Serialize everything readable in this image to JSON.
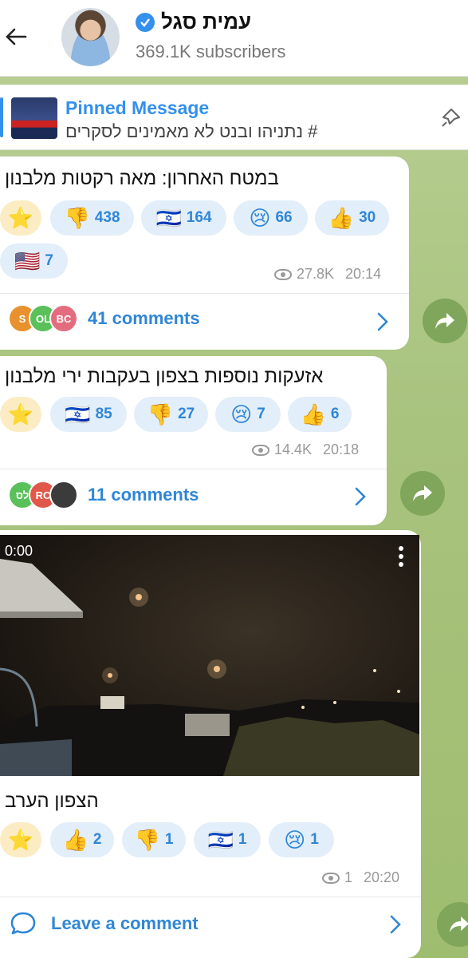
{
  "header": {
    "title": "עמית סגל",
    "subscribers": "369.1K subscribers"
  },
  "pinned": {
    "title": "Pinned Message",
    "text": "# נתניהו ובנט לא מאמינים לסקרים"
  },
  "messages": [
    {
      "text": "במטח האחרון: מאה רקטות מלבנון",
      "reactions": [
        {
          "emoji": "👎",
          "count": "438"
        },
        {
          "emoji": "🇮🇱",
          "count": "164"
        },
        {
          "emoji": "😢",
          "count": "66"
        },
        {
          "emoji": "👍",
          "count": "30"
        },
        {
          "emoji": "🇺🇸",
          "count": "7"
        }
      ],
      "views": "27.8K",
      "time": "20:14",
      "comments": "41 comments",
      "commenters": [
        "S",
        "OL",
        "BC"
      ]
    },
    {
      "text": "אזעקות נוספות בצפון בעקבות ירי מלבנון",
      "reactions": [
        {
          "emoji": "🇮🇱",
          "count": "85"
        },
        {
          "emoji": "👎",
          "count": "27"
        },
        {
          "emoji": "😢",
          "count": "7"
        },
        {
          "emoji": "👍",
          "count": "6"
        }
      ],
      "views": "14.4K",
      "time": "20:18",
      "comments": "11 comments",
      "commenters": [
        "לס",
        "RC",
        ""
      ]
    },
    {
      "video_time": "0:00",
      "text": "הצפון הערב",
      "reactions": [
        {
          "emoji": "👍",
          "count": "2"
        },
        {
          "emoji": "👎",
          "count": "1"
        },
        {
          "emoji": "🇮🇱",
          "count": "1"
        },
        {
          "emoji": "😢",
          "count": "1"
        }
      ],
      "views": "1",
      "time": "20:20",
      "comments": "Leave a comment"
    }
  ],
  "star_emoji": "⭐",
  "colors": {
    "accent": "#2f86d6",
    "reaction_bg": "#e2eef9",
    "chat_bg": "#a8c37e"
  }
}
